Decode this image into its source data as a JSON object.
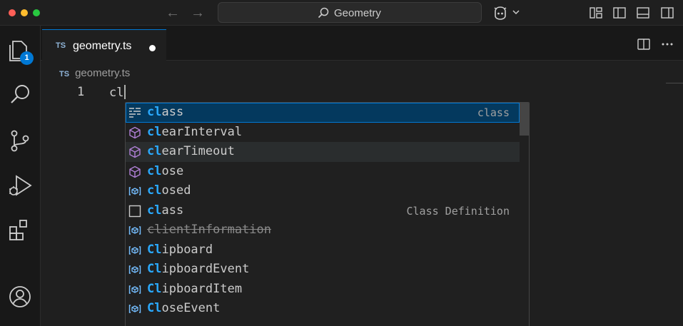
{
  "titlebar": {
    "search_label": "Geometry",
    "icons": [
      "back-arrow-icon",
      "forward-arrow-icon",
      "search-icon",
      "copilot-icon",
      "chevron-down-icon",
      "customize-layout-icon",
      "toggle-primary-sidebar-icon",
      "toggle-panel-icon",
      "toggle-secondary-sidebar-icon"
    ]
  },
  "activitybar": {
    "explorer_badge": "1",
    "items": [
      "explorer-icon",
      "search-icon",
      "source-control-icon",
      "run-debug-icon",
      "extensions-icon",
      "accounts-icon"
    ]
  },
  "tab": {
    "lang": "TS",
    "name": "geometry.ts",
    "modified": true
  },
  "editor": {
    "breadcrumb_lang": "TS",
    "breadcrumb_file": "geometry.ts",
    "line_number": "1",
    "code": "cl"
  },
  "suggest": {
    "items": [
      {
        "match": "cl",
        "rest": "ass",
        "detail": "class",
        "kind": "keyword-snippet-icon",
        "state": "selected"
      },
      {
        "match": "cl",
        "rest": "earInterval",
        "detail": "",
        "kind": "method-icon",
        "state": ""
      },
      {
        "match": "cl",
        "rest": "earTimeout",
        "detail": "",
        "kind": "method-icon",
        "state": "hover"
      },
      {
        "match": "cl",
        "rest": "ose",
        "detail": "",
        "kind": "method-icon",
        "state": ""
      },
      {
        "match": "cl",
        "rest": "osed",
        "detail": "",
        "kind": "variable-icon",
        "state": ""
      },
      {
        "match": "cl",
        "rest": "ass",
        "detail": "Class Definition",
        "kind": "snippet-icon",
        "state": ""
      },
      {
        "match": "",
        "rest": "clientInformation",
        "detail": "",
        "kind": "variable-icon",
        "state": "deprecated"
      },
      {
        "match": "Cl",
        "rest": "ipboard",
        "detail": "",
        "kind": "variable-icon",
        "state": ""
      },
      {
        "match": "Cl",
        "rest": "ipboardEvent",
        "detail": "",
        "kind": "variable-icon",
        "state": ""
      },
      {
        "match": "Cl",
        "rest": "ipboardItem",
        "detail": "",
        "kind": "variable-icon",
        "state": ""
      },
      {
        "match": "Cl",
        "rest": "oseEvent",
        "detail": "",
        "kind": "variable-icon",
        "state": ""
      }
    ]
  },
  "colors": {
    "accent": "#0078d4",
    "selection": "#04395e",
    "match_highlight": "#2aaaff",
    "method_icon": "#b180d7",
    "variable_icon": "#75beff"
  }
}
